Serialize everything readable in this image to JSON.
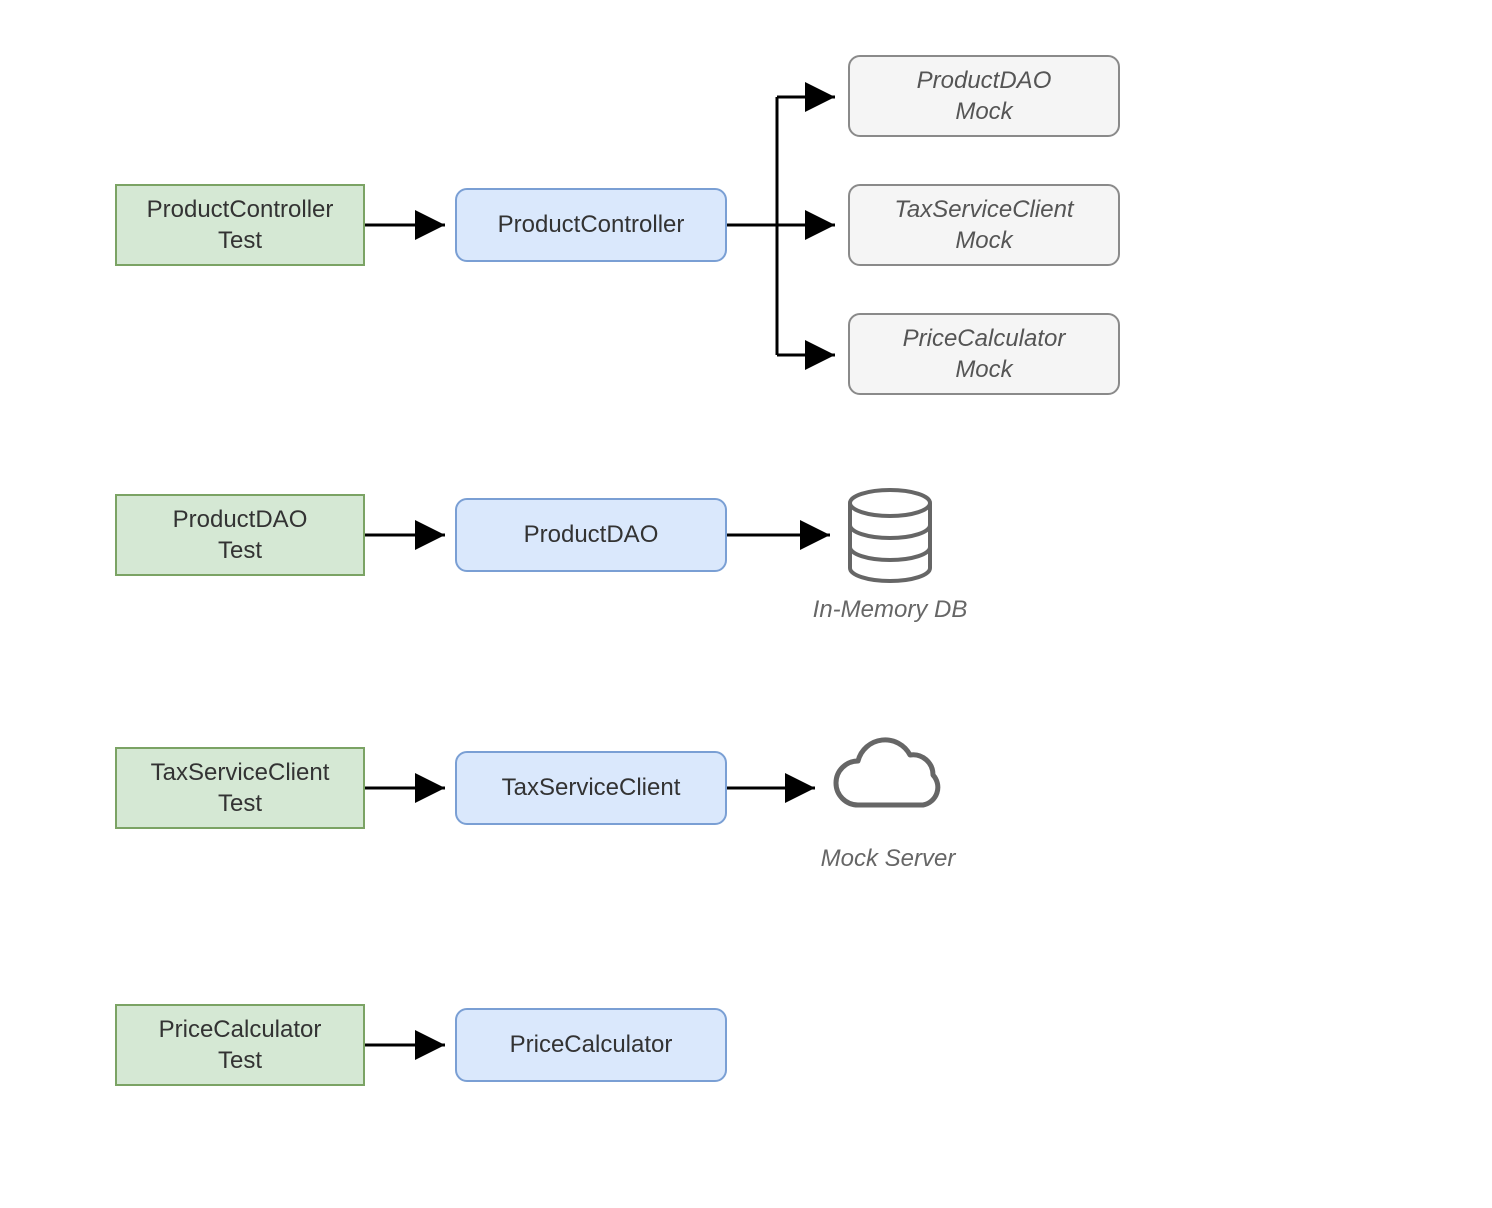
{
  "rows": {
    "row1": {
      "test": "ProductController\nTest",
      "subject": "ProductController",
      "mocks": [
        "ProductDAO\nMock",
        "TaxServiceClient\nMock",
        "PriceCalculator\nMock"
      ]
    },
    "row2": {
      "test": "ProductDAO\nTest",
      "subject": "ProductDAO",
      "caption": "In-Memory DB"
    },
    "row3": {
      "test": "TaxServiceClient\nTest",
      "subject": "TaxServiceClient",
      "caption": "Mock Server"
    },
    "row4": {
      "test": "PriceCalculator\nTest",
      "subject": "PriceCalculator"
    }
  }
}
